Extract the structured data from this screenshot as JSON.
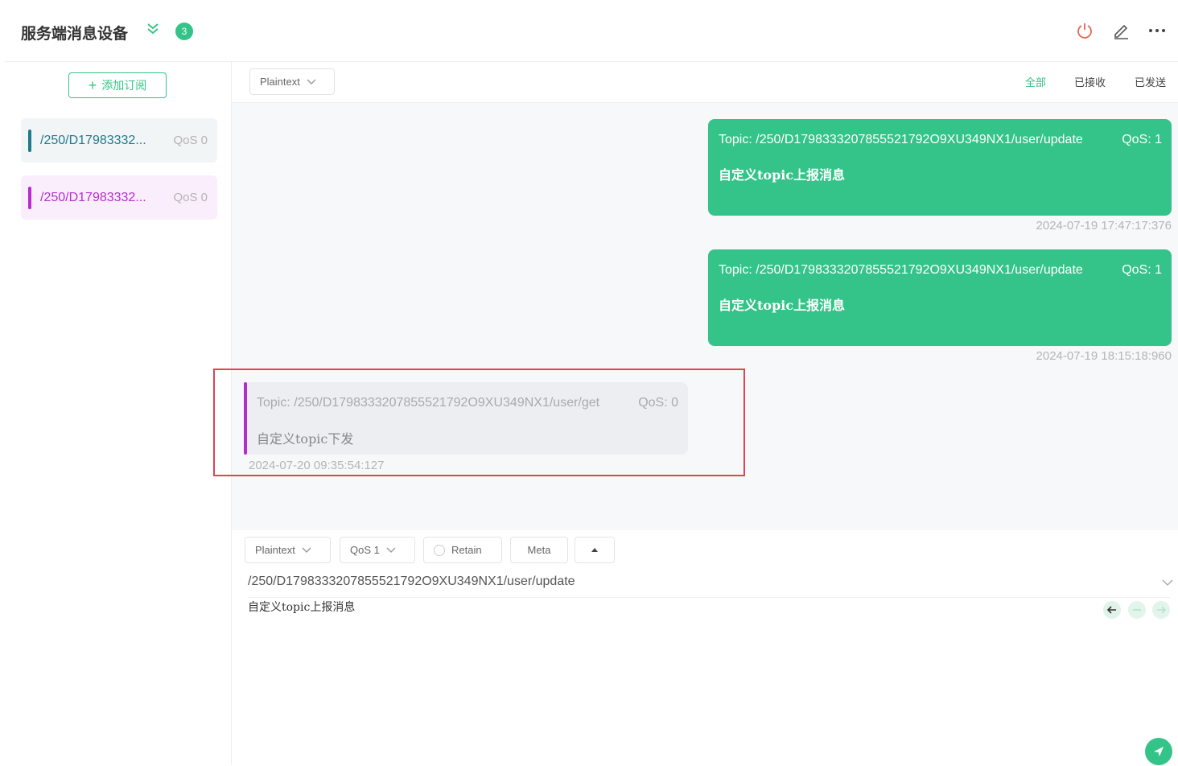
{
  "header": {
    "title": "服务端消息设备",
    "count_badge": "3",
    "icons": [
      "power-icon",
      "edit-icon",
      "more-icon"
    ]
  },
  "sidebar": {
    "add_button_label": "添加订阅",
    "subscriptions": [
      {
        "topic": "/250/D17983332...",
        "qos": "QoS 0",
        "color": "#1f7b8c"
      },
      {
        "topic": "/250/D17983332...",
        "qos": "QoS 0",
        "color": "#b62dce"
      }
    ]
  },
  "toolbar": {
    "format": "Plaintext",
    "tabs": [
      "全部",
      "已接收",
      "已发送"
    ],
    "active_tab": "全部"
  },
  "messages": [
    {
      "direction": "sent",
      "topic": "Topic: /250/D1798333207855521792O9XU349NX1/user/update",
      "qos": "QoS: 1",
      "payload": "自定义topic上报消息",
      "time": "2024-07-19 17:47:17:376"
    },
    {
      "direction": "sent",
      "topic": "Topic: /250/D1798333207855521792O9XU349NX1/user/update",
      "qos": "QoS: 1",
      "payload": "自定义topic上报消息",
      "time": "2024-07-19 18:15:18:960"
    },
    {
      "direction": "received",
      "topic": "Topic: /250/D1798333207855521792O9XU349NX1/user/get",
      "qos": "QoS: 0",
      "payload": "自定义topic下发",
      "time": "2024-07-20 09:35:54:127"
    }
  ],
  "composer": {
    "format": "Plaintext",
    "qos": "QoS 1",
    "retain_label": "Retain",
    "meta_label": "Meta",
    "topic": "/250/D1798333207855521792O9XU349NX1/user/update",
    "payload": "自定义topic上报消息"
  },
  "colors": {
    "accent": "#34c388",
    "received_bar": "#b62dce",
    "highlight_border": "#e0444d"
  }
}
